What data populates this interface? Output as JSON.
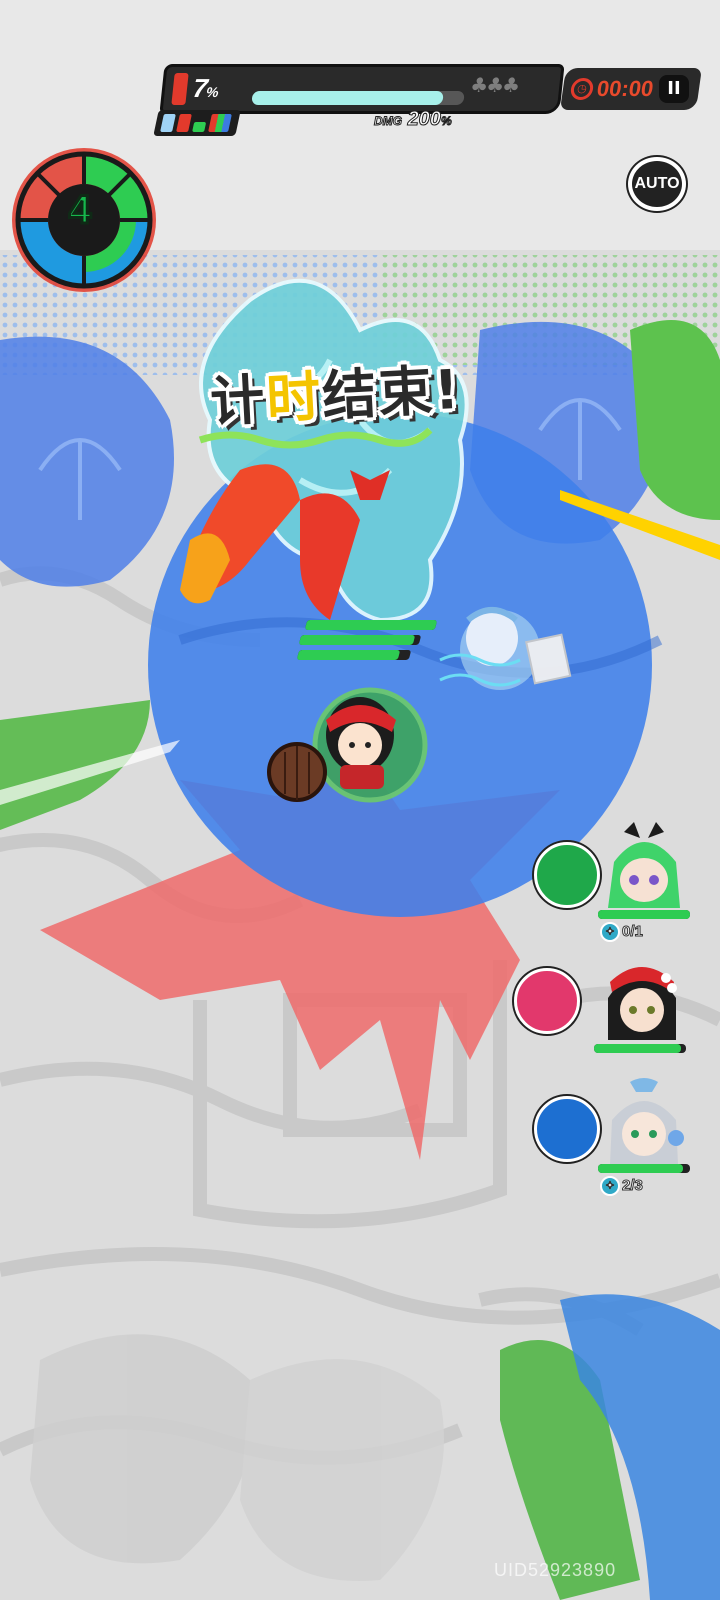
{
  "boss_bar": {
    "percent": "7",
    "percent_sign": "%",
    "hp_fraction": 0.9,
    "dmg_label": "DMG",
    "dmg_value": "200",
    "dmg_unit": "%"
  },
  "timer": {
    "value": "00:00",
    "pause_label": "II"
  },
  "auto_button": {
    "label": "AUTO"
  },
  "wave": {
    "number": "4"
  },
  "banner": {
    "part1": "计",
    "highlight": "时",
    "part2": "结束!"
  },
  "party": [
    {
      "name": "green-haired-ally",
      "hp_fraction": 1.0,
      "charge": "0/1",
      "orb_color": "#1fa84a"
    },
    {
      "name": "red-hat-ally",
      "hp_fraction": 0.95,
      "charge": "",
      "orb_color": "#e2386c"
    },
    {
      "name": "silver-haired-ally",
      "hp_fraction": 0.92,
      "charge": "2/3",
      "orb_color": "#1d6fd1"
    }
  ],
  "uid": "UID52923890",
  "colors": {
    "accent_red": "#e23a2c",
    "accent_green": "#2ecc52",
    "accent_blue": "#3c7be0",
    "banner_yellow": "#f4c400"
  }
}
